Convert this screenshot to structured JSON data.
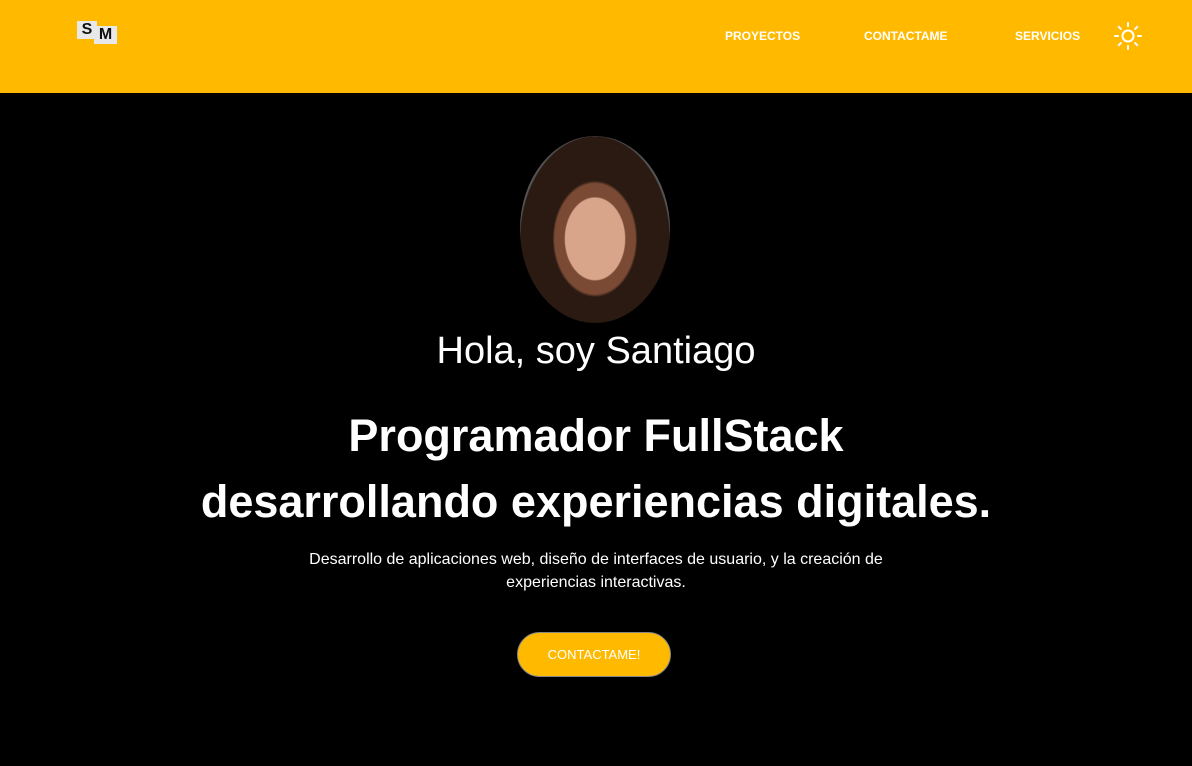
{
  "header": {
    "logo": {
      "s": "S",
      "m": "M"
    },
    "nav": [
      "PROYECTOS",
      "CONTACTAME",
      "SERVICIOS"
    ],
    "theme_icon": "sun-icon"
  },
  "hero": {
    "greeting": "Hola, soy Santiago",
    "title_line1": "Programador FullStack",
    "title_line2": "desarrollando experiencias digitales.",
    "description_line1": "Desarrollo de aplicaciones web, diseño de interfaces de usuario, y la creación de",
    "description_line2": "experiencias interactivas.",
    "cta": "CONTACTAME!"
  },
  "colors": {
    "accent": "#FFBA00",
    "background": "#000000"
  }
}
